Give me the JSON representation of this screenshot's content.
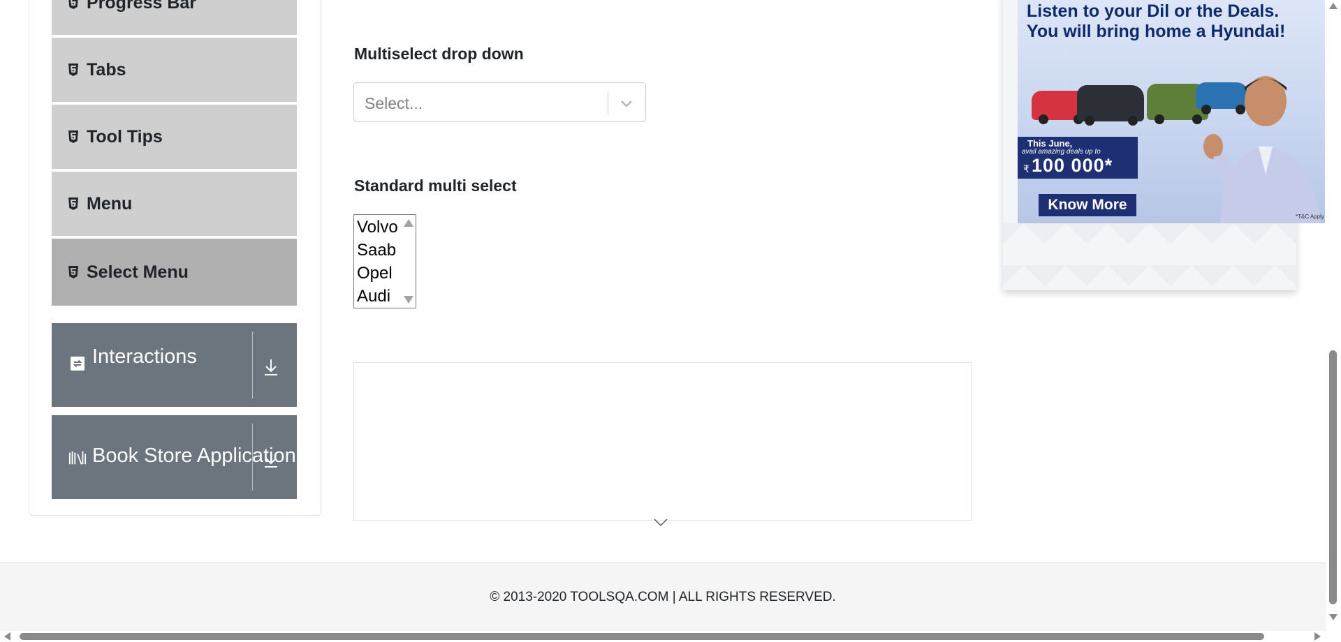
{
  "sidebar": {
    "items": [
      {
        "label": "Progress Bar",
        "icon": "html5-icon"
      },
      {
        "label": "Tabs",
        "icon": "html5-icon"
      },
      {
        "label": "Tool Tips",
        "icon": "html5-icon"
      },
      {
        "label": "Menu",
        "icon": "html5-icon"
      },
      {
        "label": "Select Menu",
        "icon": "html5-icon",
        "active": true
      }
    ],
    "groups": [
      {
        "label": "Interactions",
        "icon": "interactions-icon"
      },
      {
        "label": "Book Store Application",
        "icon": "book-store-icon"
      }
    ]
  },
  "main": {
    "multiselect": {
      "label": "Multiselect drop down",
      "placeholder": "Select..."
    },
    "standard_multiselect": {
      "label": "Standard multi select",
      "options": [
        "Volvo",
        "Saab",
        "Opel",
        "Audi"
      ]
    }
  },
  "ad": {
    "headline_line1": "Listen to your Dil or the Deals.",
    "headline_line2": "You will bring home a Hyundai!",
    "promo_line1": "This June,",
    "promo_line2": "avail amazing deals up to",
    "promo_amount": "100 000*",
    "currency": "₹",
    "cta": "Know More",
    "tc": "*T&C Apply"
  },
  "footer": {
    "text": "© 2013-2020 TOOLSQA.COM | ALL RIGHTS RESERVED."
  },
  "colors": {
    "sidebar_item": "#cfcfcf",
    "sidebar_item_active": "#b0b0b0",
    "group_header": "#6c757d",
    "ad_navy": "#1f2f73"
  }
}
